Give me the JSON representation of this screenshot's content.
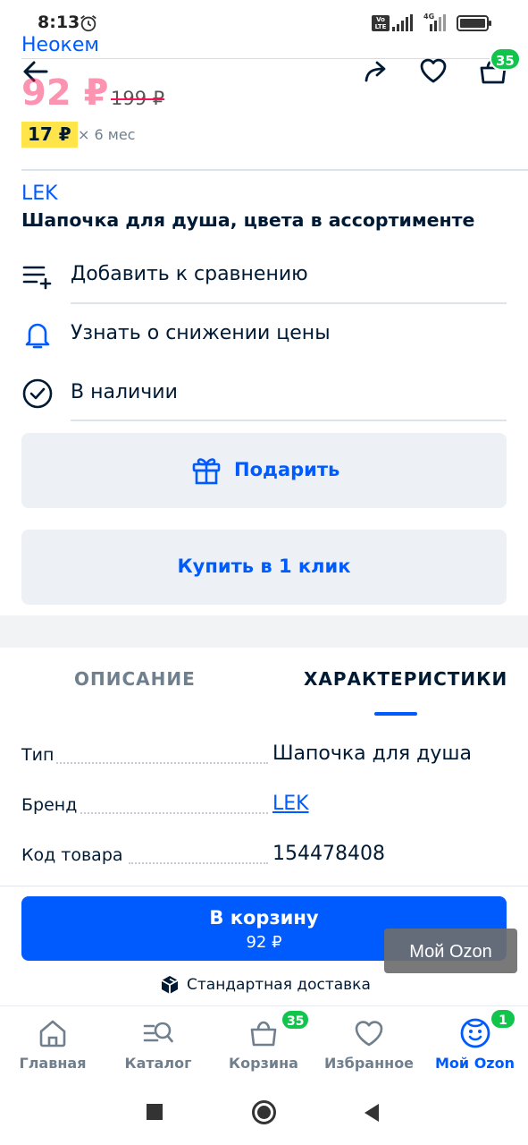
{
  "status_bar": {
    "time": "8:13",
    "volte_label": "Vo LTE",
    "network_label": "4G",
    "icons": [
      "alarm-icon",
      "volte-icon",
      "signal-icon",
      "signal-icon",
      "battery-icon"
    ]
  },
  "header": {
    "seller_name": "Неокем",
    "cart_badge": "35",
    "icons": [
      "back-arrow-icon",
      "share-icon",
      "heart-icon",
      "cart-icon"
    ]
  },
  "price": {
    "current": "92 ₽",
    "old": "199 ₽",
    "installment_amount": "17 ₽",
    "installment_term": "× 6 мес"
  },
  "product": {
    "brand": "LEK",
    "title": "Шапочка для душа, цвета в ассортименте"
  },
  "actions": [
    {
      "label": "Добавить к сравнению",
      "icon": "compare-list-icon"
    },
    {
      "label": "Узнать о снижении цены",
      "icon": "bell-icon"
    },
    {
      "label": "В наличии",
      "icon": "check-circle-icon"
    }
  ],
  "buttons": {
    "gift_label": "Подарить",
    "one_click_label": "Купить в 1 клик"
  },
  "tabs": {
    "description": "ОПИСАНИЕ",
    "characteristics": "ХАРАКТЕРИСТИКИ",
    "active": "characteristics"
  },
  "specs": [
    {
      "key": "Тип",
      "value": "Шапочка для душа"
    },
    {
      "key": "Бренд",
      "value": "LEK"
    },
    {
      "key": "Код товара",
      "value": "154478408"
    }
  ],
  "cart_button": {
    "label": "В корзину",
    "price": "92 ₽"
  },
  "toast": {
    "text": "Мой Ozon"
  },
  "delivery": {
    "label": "Стандартная доставка",
    "icon": "box-icon"
  },
  "bottom_nav": [
    {
      "label": "Главная",
      "icon": "home-icon"
    },
    {
      "label": "Каталог",
      "icon": "catalog-search-icon"
    },
    {
      "label": "Корзина",
      "icon": "cart-icon",
      "badge": "35"
    },
    {
      "label": "Избранное",
      "icon": "heart-icon"
    },
    {
      "label": "Мой Ozon",
      "icon": "smiley-face-icon",
      "badge": "1",
      "active": true
    }
  ],
  "colors": {
    "accent": "#005bff",
    "price": "#f91155",
    "badge": "#10c44c",
    "installment": "#ffe44a",
    "button_bg": "#edf0f4"
  },
  "system_nav": [
    "recent-apps-icon",
    "home-circle-icon",
    "back-triangle-icon"
  ]
}
